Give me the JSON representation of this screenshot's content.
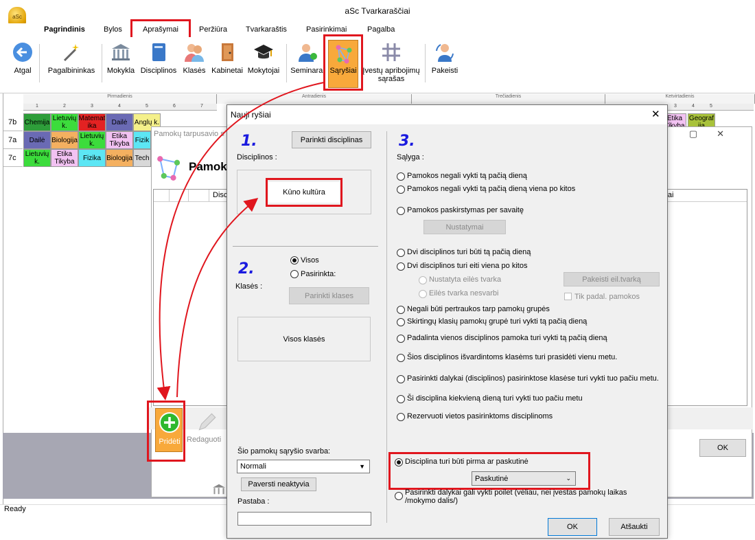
{
  "app": {
    "title": "aSc Tvarkaraščiai",
    "bell_label": "aSc"
  },
  "menu": [
    "Pagrindinis",
    "Bylos",
    "Aprašymai",
    "Peržiūra",
    "Tvarkaraštis",
    "Pasirinkimai",
    "Pagalba"
  ],
  "toolbar": {
    "back": "Atgal",
    "wizard": "Pagalbininkas",
    "school": "Mokykla",
    "subjects": "Disciplinos",
    "classes": "Klasės",
    "rooms": "Kabinetai",
    "teachers": "Mokytojai",
    "seminars": "Seminarai",
    "relations": "Sąryšiai",
    "constraints": "Įvestų apribojimų sąrašas",
    "changes": "Pakeisti"
  },
  "grid": {
    "days": [
      "Pirmadienis",
      "Antradienis",
      "Trečiadienis",
      "Ketvirtadienis"
    ],
    "period_numbers": [
      "1",
      "2",
      "3",
      "4",
      "5",
      "6",
      "7"
    ],
    "right_numbers": [
      "3",
      "4",
      "5"
    ],
    "rows": [
      {
        "label": "7b",
        "cells": [
          "Chemija",
          "Lietuvių k.",
          "Matemat ika",
          "Dailė",
          "Anglų k."
        ],
        "right_cells": [
          "Etika Tikyba",
          "Geograf ija"
        ]
      },
      {
        "label": "7a",
        "cells": [
          "Dailė",
          "Biologija",
          "Lietuvių k.",
          "Etika Tikyba",
          "Fizik"
        ]
      },
      {
        "label": "7c",
        "cells": [
          "Lietuvių k.",
          "Etika Tikyba",
          "Fizika",
          "Biologija",
          "Tech"
        ]
      }
    ],
    "colors": {
      "green_dark": "#2e9e3a",
      "green": "#3cdc3c",
      "red": "#e32222",
      "blue": "#6a6ab4",
      "yellow": "#f4f08a",
      "pink": "#f2c2f2",
      "cyan": "#5ce6f4",
      "orange": "#f4b060",
      "gray": "#d8d8d8",
      "olive": "#a8c23a"
    }
  },
  "bg_window": {
    "title": "Pamokų tarpusavio s",
    "heading": "Pamok",
    "col_disc": "Disc",
    "col_params": "etrai",
    "add_label": "Pridėti",
    "edit_label": "Redaguoti",
    "ok": "OK"
  },
  "dialog": {
    "title": "Nauji ryšiai",
    "step1": "1.",
    "step2": "2.",
    "step3": "3.",
    "pick_subjects": "Parinkti disciplinas",
    "subjects_label": "Disciplinos :",
    "selected_subject": "Kūno kultūra",
    "classes_label": "Klasės :",
    "radio_all": "Visos",
    "radio_selected": "Pasirinkta:",
    "pick_classes": "Parinkti klases",
    "all_classes": "Visos klasės",
    "importance_label": "Šio pamokų sąryšio svarba:",
    "importance_value": "Normali",
    "make_inactive": "Paversti neaktyvia",
    "note_label": "Pastaba :",
    "note_value": "",
    "condition_label": "Sąlyga :",
    "conditions": [
      "Pamokos negali vykti tą pačią dieną",
      "Pamokos negali vykti tą pačią dieną viena po kitos",
      "Pamokos paskirstymas per savaitę",
      "Dvi disciplinos turi būti tą pačią dieną",
      "Dvi disciplinos turi eiti viena po kitos",
      "Negali būti pertraukos tarp pamokų grupės",
      "Skirtingų klasių pamokų grupė turi vykti tą pačią dieną",
      "Padalinta vienos disciplinos pamoka turi vykti tą pačią dieną",
      "Šios disciplinos išvardintoms klasėms turi prasidėti vienu metu.",
      "Pasirinkti dalykai (disciplinos) pasirinktose klasėse turi vykti tuo pačiu metu.",
      "Ši disciplina kiekvieną dieną turi vykti tuo pačiu metu",
      "Rezervuoti vietos pasirinktoms disciplinoms",
      "Disciplina turi būti pirma ar paskutinė",
      "Pasirinkti dalykai gali vykti poilet (vėliau, nei įvestas pamokų laikas /mokymo dalis/)"
    ],
    "settings_btn": "Nustatymai",
    "order_fixed": "Nustatyta eilės tvarka",
    "order_free": "Eilės tvarka nesvarbi",
    "change_order": "Pakeisti eil.tvarką",
    "only_lessons": "Tik padal. pamokos",
    "first_last_value": "Paskutinė",
    "ok": "OK",
    "cancel": "Atšaukti"
  },
  "status": "Ready",
  "colors": {
    "highlight": "#e0161e",
    "accent_orange": "#f8a93b",
    "step_blue": "#1a1adf"
  }
}
